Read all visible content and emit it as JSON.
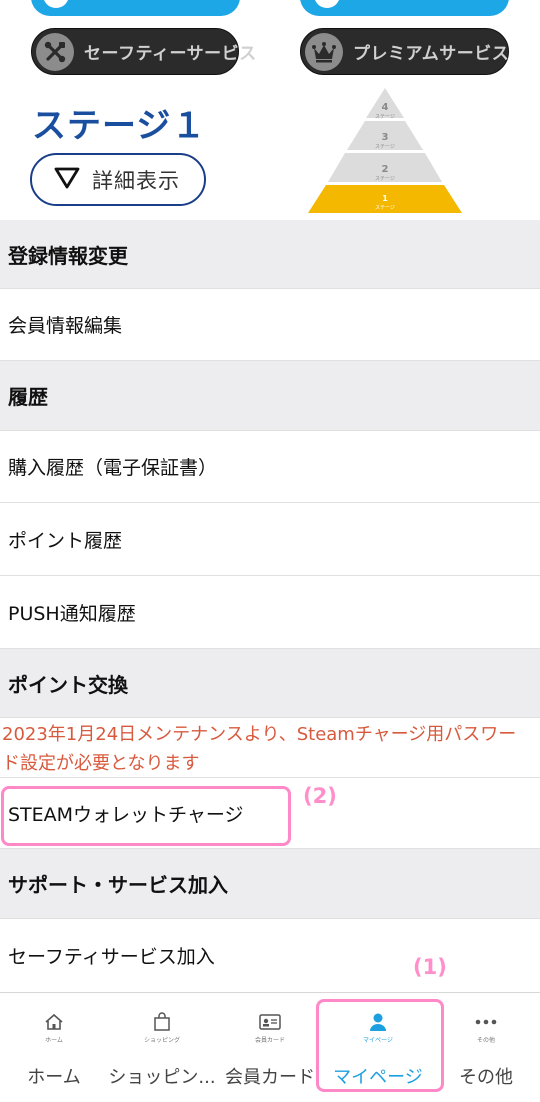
{
  "hero": {
    "safety_service_label": "セーフティーサービス",
    "premium_service_label": "プレミアムサービス",
    "stage_title": "ステージ１",
    "detail_button_label": "詳細表示",
    "pyramid": {
      "levels": [
        {
          "number": "4",
          "label": "ステージ"
        },
        {
          "number": "3",
          "label": "ステージ"
        },
        {
          "number": "2",
          "label": "ステージ"
        },
        {
          "number": "1",
          "label": "ステージ"
        }
      ],
      "active_level": "1",
      "active_color": "#f5b800",
      "inactive_color": "#dcdcdc"
    }
  },
  "sections": {
    "registration_header": "登録情報変更",
    "member_info_edit": "会員情報編集",
    "history_header": "履歴",
    "purchase_history": "購入履歴（電子保証書）",
    "point_history": "ポイント履歴",
    "push_history": "PUSH通知履歴",
    "point_exchange_header": "ポイント交換",
    "maintenance_notice": "2023年1月24日メンテナンスより、Steamチャージ用パスワード設定が必要となります",
    "steam_wallet_charge": "STEAMウォレットチャージ",
    "support_header": "サポート・サービス加入",
    "safety_service_join": "セーフティサービス加入"
  },
  "annotations": {
    "label_1": "(1)",
    "label_2": "(2)",
    "highlight_color": "#ff88c8"
  },
  "bottom_nav": {
    "home": {
      "tiny": "ホーム",
      "label": "ホーム"
    },
    "shopping": {
      "tiny": "ショッピング",
      "label": "ショッピン..."
    },
    "member_card": {
      "tiny": "会員カード",
      "label": "会員カード"
    },
    "mypage": {
      "tiny": "マイページ",
      "label": "マイページ"
    },
    "other": {
      "tiny": "その他",
      "label": "その他"
    },
    "active_item": "mypage",
    "active_color": "#1ea0e0"
  },
  "colors": {
    "brand_blue": "#1a4fa0",
    "notice_red": "#d85a3e",
    "section_header_bg": "#ededf0"
  }
}
